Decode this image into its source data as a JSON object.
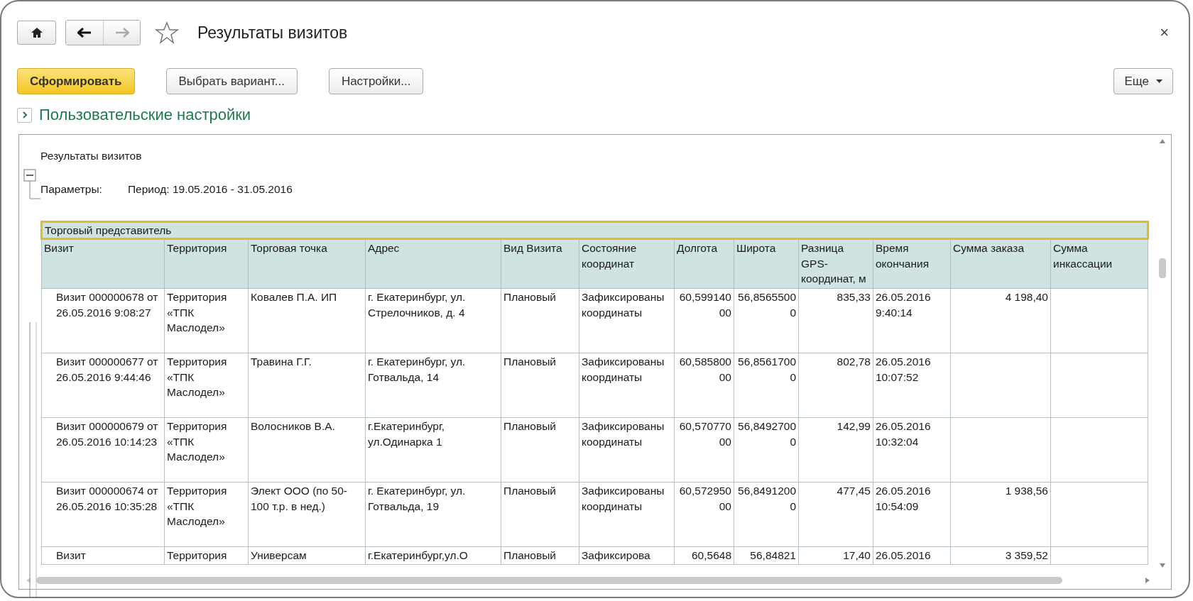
{
  "window": {
    "title": "Результаты визитов",
    "close": "×",
    "favorite": false
  },
  "toolbar": {
    "buttons": [
      {
        "label": "Сформировать",
        "kind": "primary"
      },
      {
        "label": "Выбрать вариант...",
        "kind": "normal"
      },
      {
        "label": "Настройки...",
        "kind": "normal"
      }
    ],
    "more": "Еще"
  },
  "user_settings": {
    "label": "Пользовательские настройки",
    "expanded": false
  },
  "report": {
    "title": "Результаты визитов",
    "parameters_label": "Параметры:",
    "parameters_value": "Период: 19.05.2016 - 31.05.2016",
    "group_header": "Торговый представитель",
    "columns": [
      "Визит",
      "Территория",
      "Торговая точка",
      "Адрес",
      "Вид Визита",
      "Состояние координат",
      "Долгота",
      "Широта",
      "Разница GPS-координат, м",
      "Время окончания",
      "Сумма заказа",
      "Сумма инкассации"
    ],
    "rows": [
      {
        "visit": "Визит 000000678 от 26.05.2016 9:08:27",
        "territory": "Территория «ТПК Маслодел»",
        "outlet": "Ковалев П.А. ИП",
        "address": "г. Екатеринбург, ул. Стрелочников, д. 4",
        "visit_type": "Плановый",
        "coord_state": "Зафиксированы координаты",
        "longitude": "60,59914000",
        "latitude": "56,85655000",
        "gps_diff": "835,33",
        "end_time": "26.05.2016 9:40:14",
        "order_sum": "4 198,40"
      },
      {
        "visit": "Визит 000000677 от 26.05.2016 9:44:46",
        "territory": "Территория «ТПК Маслодел»",
        "outlet": "Травина Г.Г.",
        "address": "г. Екатеринбург, ул. Готвальда, 14",
        "visit_type": "Плановый",
        "coord_state": "Зафиксированы координаты",
        "longitude": "60,58580000",
        "latitude": "56,85617000",
        "gps_diff": "802,78",
        "end_time": "26.05.2016 10:07:52"
      },
      {
        "visit": "Визит 000000679 от 26.05.2016 10:14:23",
        "territory": "Территория «ТПК Маслодел»",
        "outlet": "Волосников В.А.",
        "address": "г.Екатеринбург, ул.Одинарка 1",
        "visit_type": "Плановый",
        "coord_state": "Зафиксированы координаты",
        "longitude": "60,57077000",
        "latitude": "56,84927000",
        "gps_diff": "142,99",
        "end_time": "26.05.2016 10:32:04"
      },
      {
        "visit": "Визит 000000674 от 26.05.2016 10:35:28",
        "territory": "Территория «ТПК Маслодел»",
        "outlet": "Элект ООО (по 50-100 т.р. в нед.)",
        "address": "г. Екатеринбург, ул. Готвальда, 19",
        "visit_type": "Плановый",
        "coord_state": "Зафиксированы координаты",
        "longitude": "60,57295000",
        "latitude": "56,84912000",
        "gps_diff": "477,45",
        "end_time": "26.05.2016 10:54:09",
        "order_sum": "1 938,56"
      },
      {
        "visit": "Визит",
        "territory": "Территория",
        "outlet": "Универсам",
        "address": "г.Екатеринбург,ул.О",
        "visit_type": "Плановый",
        "coord_state": "Зафиксирова",
        "longitude": "60,5648",
        "latitude": "56,84821",
        "gps_diff": "17,40",
        "end_time": "26.05.2016",
        "order_sum": "3 359,52"
      }
    ]
  }
}
